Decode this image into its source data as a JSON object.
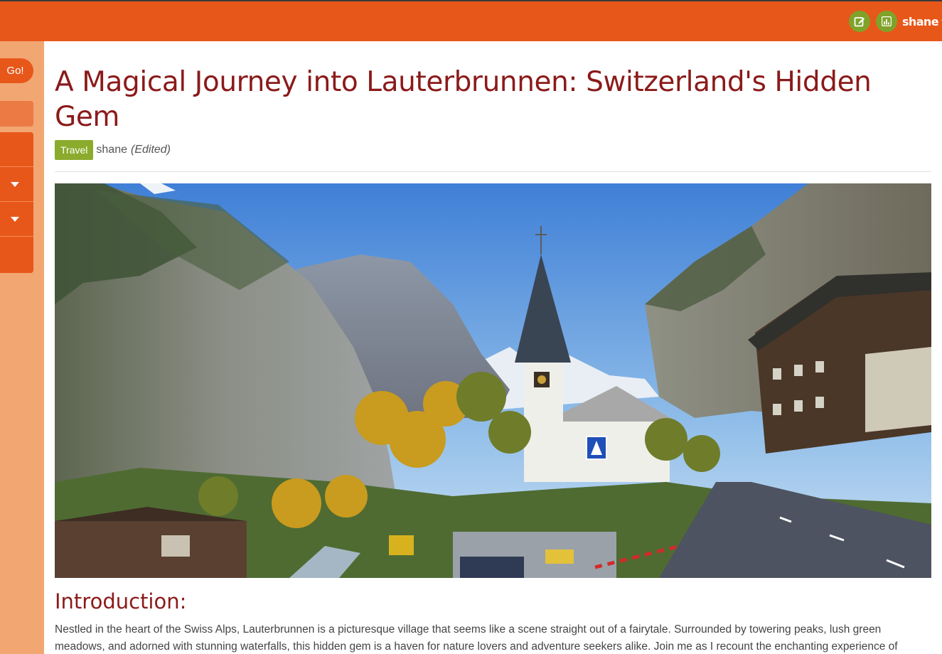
{
  "topbar": {
    "edit_icon": "pencil-square-icon",
    "stats_icon": "bar-chart-icon",
    "username": "shane",
    "accent": "#e8571a",
    "button_color": "#7fa32a"
  },
  "sidebar": {
    "search_button": "Go!",
    "expanders": [
      "chevron-down-icon",
      "chevron-down-icon"
    ]
  },
  "post": {
    "title": "A Magical Journey into Lauterbrunnen: Switzerland's Hidden Gem",
    "category": "Travel",
    "author": "shane",
    "edited": "(Edited)",
    "hero_image": "Lauterbrunnen valley with church spire, cliffs, autumn trees and road",
    "intro_heading": "Introduction:",
    "intro_text": "Nestled in the heart of the Swiss Alps, Lauterbrunnen is a picturesque village that seems like a scene straight out of a fairytale. Surrounded by towering peaks, lush green meadows, and adorned with stunning waterfalls, this hidden gem is a haven for nature lovers and adventure seekers alike. Join me as I recount the enchanting experience of",
    "title_color": "#8b1a1a",
    "badge_color": "#8aab2c"
  }
}
